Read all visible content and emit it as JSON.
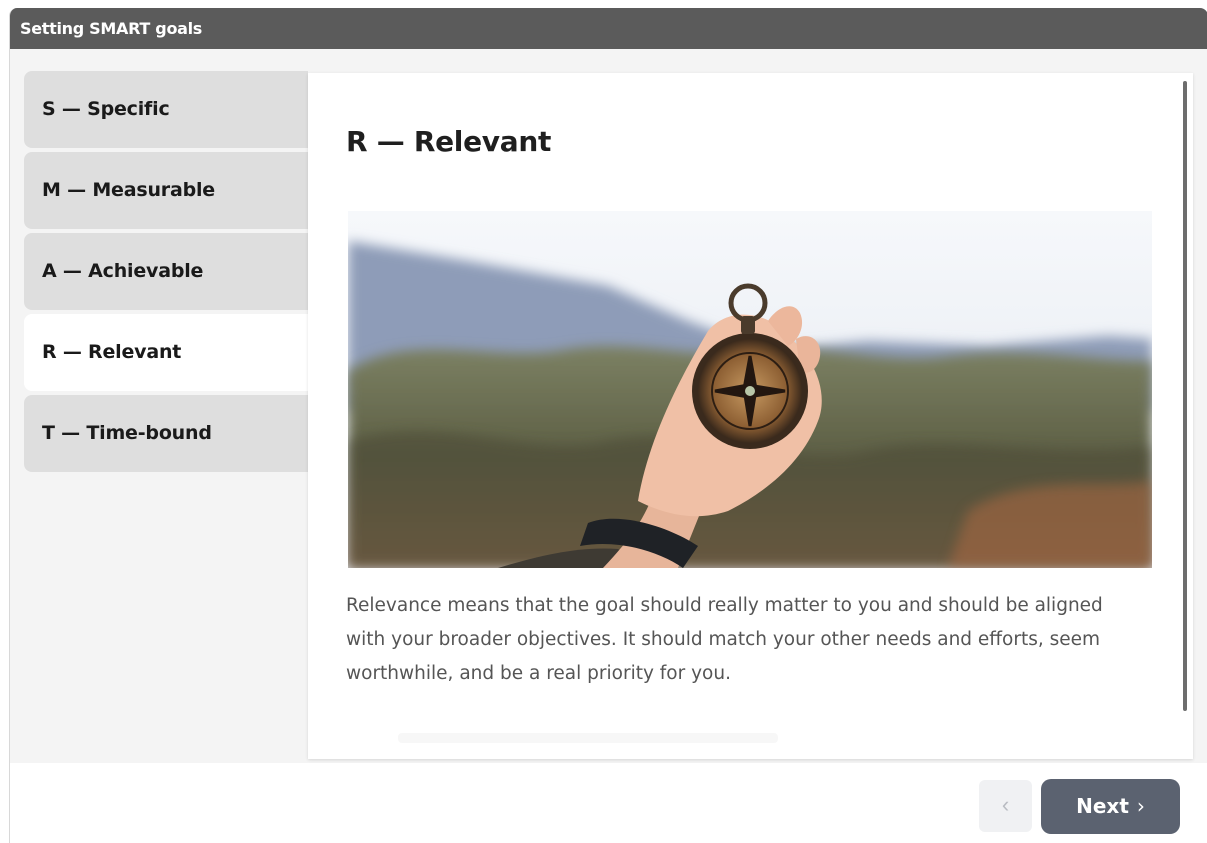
{
  "window": {
    "title": "Setting SMART goals"
  },
  "tabs": [
    {
      "label": "S — Specific",
      "active": false
    },
    {
      "label": "M — Measurable",
      "active": false
    },
    {
      "label": "A — Achievable",
      "active": false
    },
    {
      "label": "R — Relevant",
      "active": true
    },
    {
      "label": "T — Time-bound",
      "active": false
    }
  ],
  "panel": {
    "heading": "R — Relevant",
    "image_subject": "hand holding a compass against a mountain landscape",
    "body": "Relevance means that the goal should really matter to you and should be aligned with your broader objectives. It should match your other needs and efforts, seem worthwhile, and be a real priority for you."
  },
  "footer": {
    "prev_icon": "‹",
    "next_label": "Next",
    "next_icon": "›"
  },
  "colors": {
    "titlebar": "#5b5b5b",
    "tab_inactive": "#dedede",
    "tab_active": "#ffffff",
    "next_button": "#5b6270",
    "prev_button": "#f0f1f3"
  }
}
